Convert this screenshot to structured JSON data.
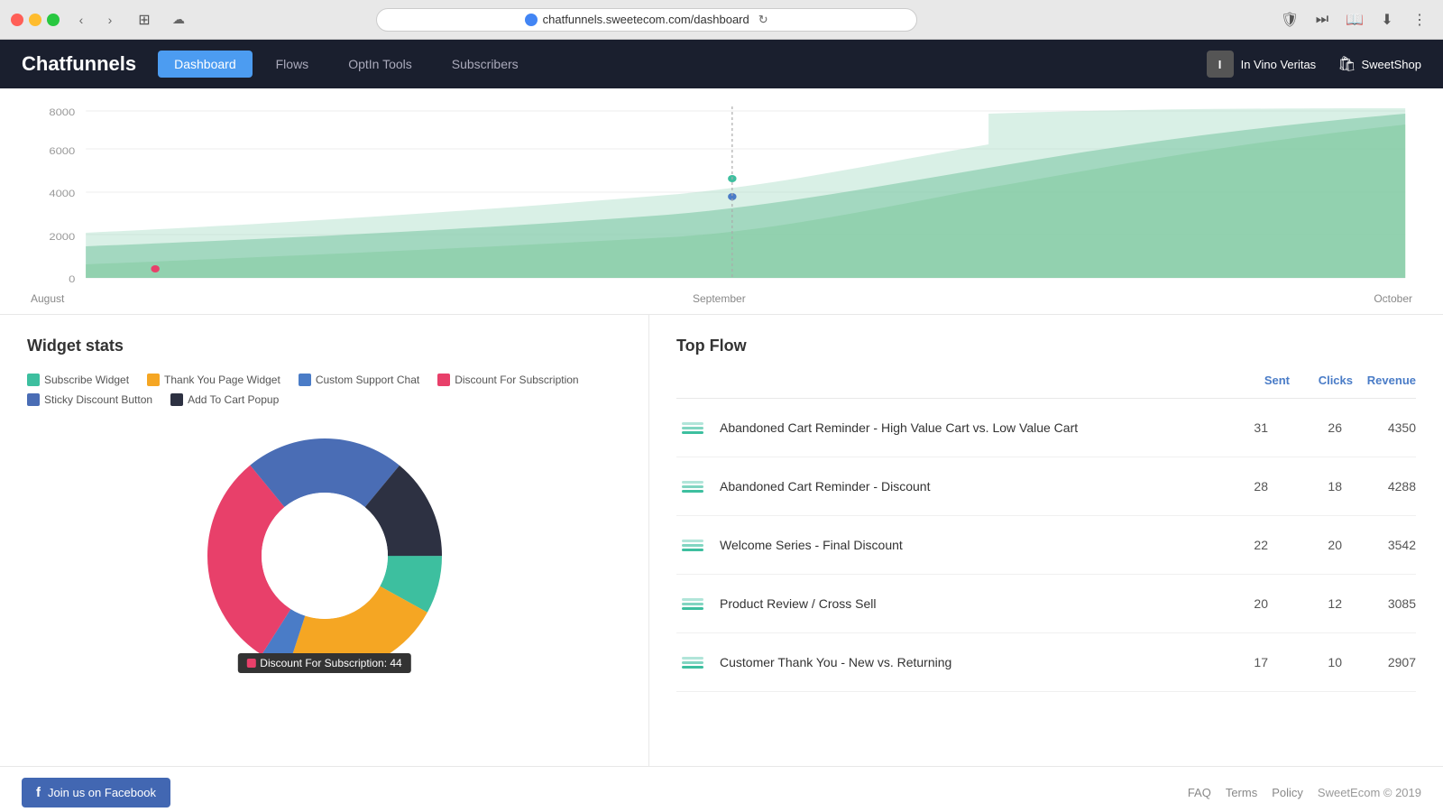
{
  "browser": {
    "url": "chatfunnels.sweetecom.com/dashboard",
    "reload_label": "⟳"
  },
  "navbar": {
    "logo": "Chatfunnels",
    "nav_items": [
      {
        "label": "Dashboard",
        "active": true
      },
      {
        "label": "Flows",
        "active": false
      },
      {
        "label": "OptIn Tools",
        "active": false
      },
      {
        "label": "Subscribers",
        "active": false
      }
    ],
    "user_initial": "I",
    "user_name": "In Vino Veritas",
    "store_name": "SweetShop"
  },
  "chart": {
    "y_labels": [
      "0",
      "2000",
      "4000",
      "6000",
      "8000"
    ],
    "x_labels": [
      "August",
      "September",
      "October"
    ]
  },
  "widget_stats": {
    "title": "Widget stats",
    "legend": [
      {
        "label": "Subscribe Widget",
        "color": "#3dbf9f"
      },
      {
        "label": "Thank You Page Widget",
        "color": "#f5a623"
      },
      {
        "label": "Custom Support Chat",
        "color": "#4a7cc7"
      },
      {
        "label": "Discount For Subscription",
        "color": "#e8406a"
      },
      {
        "label": "Sticky Discount Button",
        "color": "#4a6db5"
      },
      {
        "label": "Add To Cart Popup",
        "color": "#2d3142"
      }
    ],
    "donut": {
      "segments": [
        {
          "label": "Subscribe Widget",
          "color": "#3dbf9f",
          "pct": 8
        },
        {
          "label": "Thank You Page Widget",
          "color": "#f5a623",
          "pct": 22
        },
        {
          "label": "Custom Support Chat",
          "color": "#4a7cc7",
          "pct": 4
        },
        {
          "label": "Discount For Subscription",
          "color": "#e8406a",
          "pct": 30
        },
        {
          "label": "Sticky Discount Button",
          "color": "#4a6db5",
          "pct": 22
        },
        {
          "label": "Add To Cart Popup",
          "color": "#2d3142",
          "pct": 14
        }
      ],
      "tooltip": "Discount For Subscription: 44"
    }
  },
  "top_flow": {
    "title": "Top Flow",
    "headers": [
      "Sent",
      "Clicks",
      "Revenue"
    ],
    "rows": [
      {
        "name": "Abandoned Cart Reminder - High Value Cart vs. Low Value Cart",
        "sent": 31,
        "clicks": 26,
        "revenue": 4350
      },
      {
        "name": "Abandoned Cart Reminder - Discount",
        "sent": 28,
        "clicks": 18,
        "revenue": 4288
      },
      {
        "name": "Welcome Series - Final Discount",
        "sent": 22,
        "clicks": 20,
        "revenue": 3542
      },
      {
        "name": "Product Review / Cross Sell",
        "sent": 20,
        "clicks": 12,
        "revenue": 3085
      },
      {
        "name": "Customer Thank You - New vs. Returning",
        "sent": 17,
        "clicks": 10,
        "revenue": 2907
      }
    ]
  },
  "footer": {
    "fb_button": "Join us on Facebook",
    "links": [
      "FAQ",
      "Terms",
      "Policy"
    ],
    "copyright": "SweetEcom © 2019"
  }
}
